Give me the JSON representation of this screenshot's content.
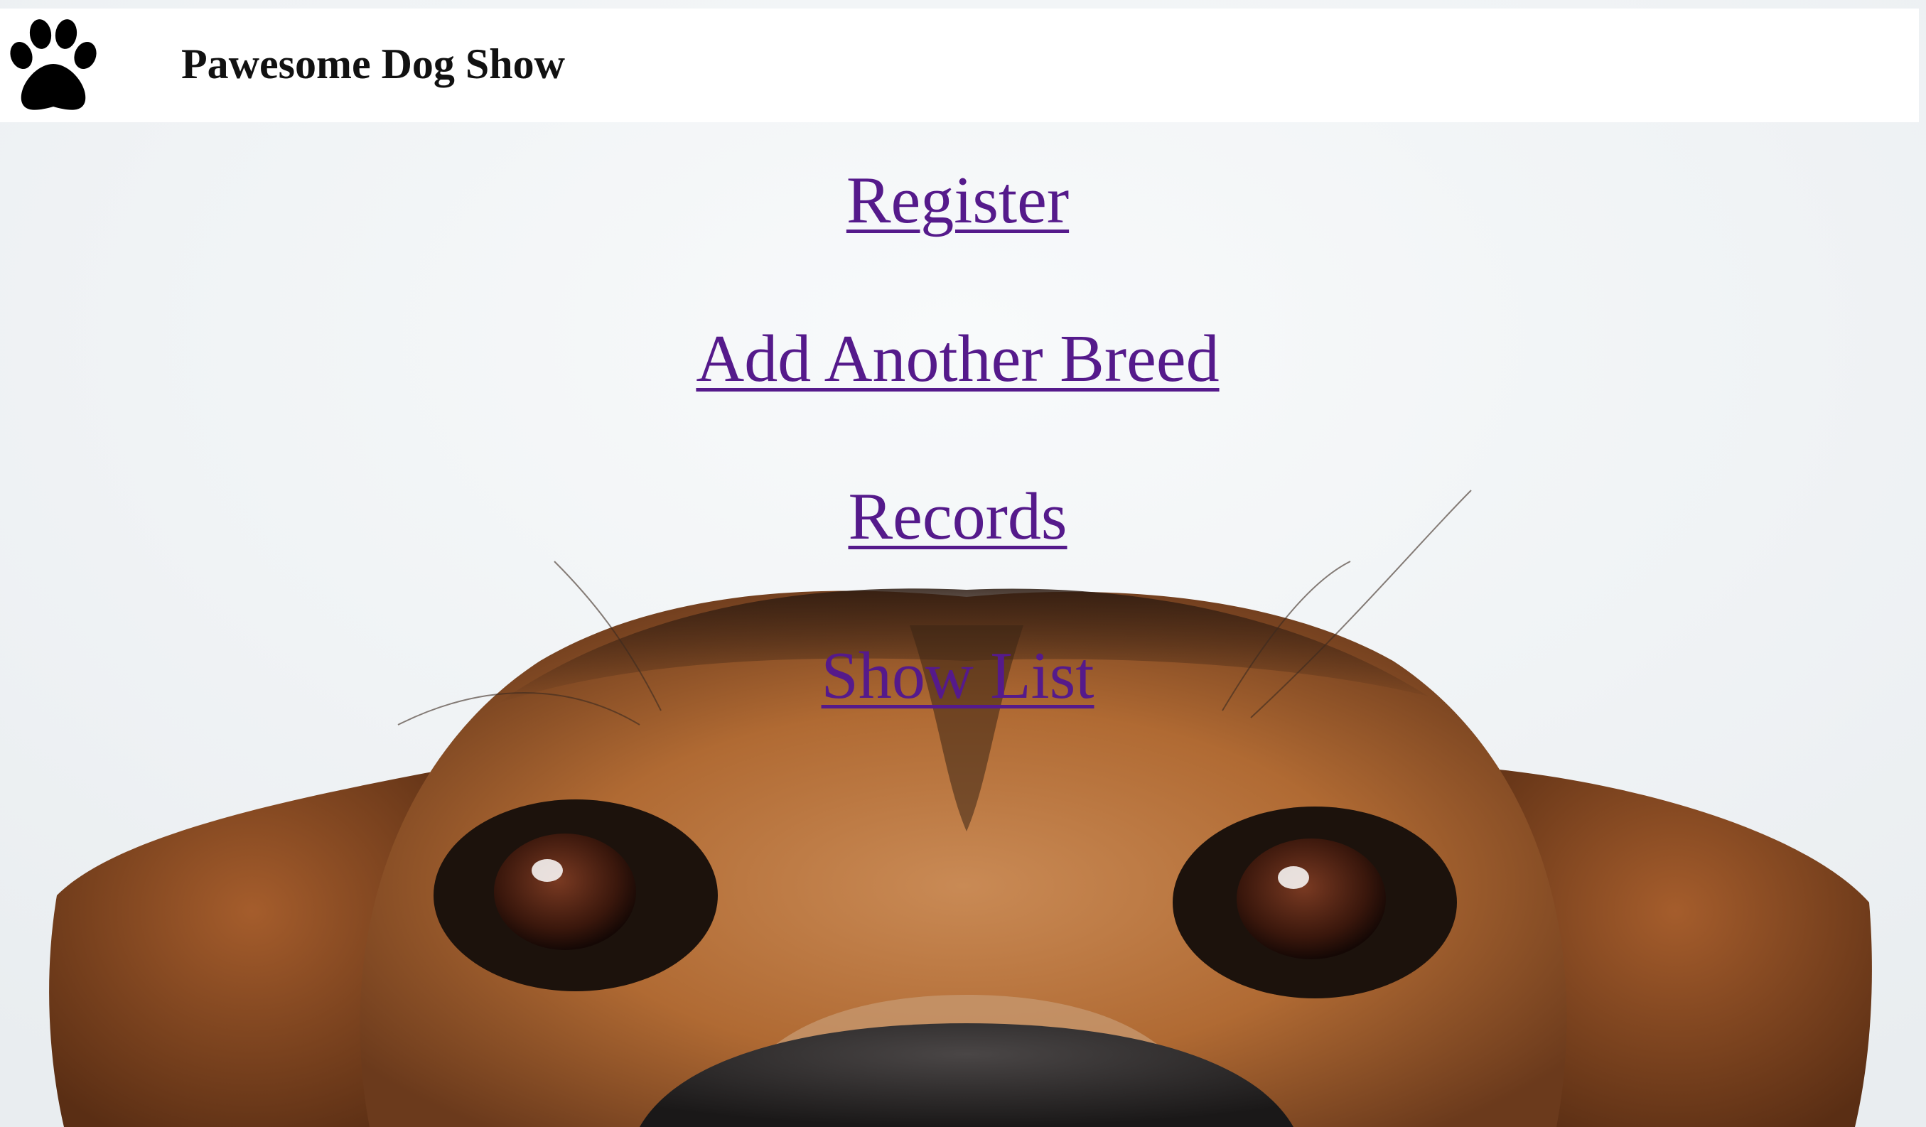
{
  "header": {
    "brand_title": "Pawesome Dog Show",
    "logo_icon": "paw-print-icon"
  },
  "nav": {
    "links": [
      {
        "label": "Register"
      },
      {
        "label": "Add Another Breed"
      },
      {
        "label": "Records"
      },
      {
        "label": "Show List"
      }
    ],
    "link_color": "#551a8b"
  },
  "hero": {
    "image_subject": "dog-face-photo"
  }
}
